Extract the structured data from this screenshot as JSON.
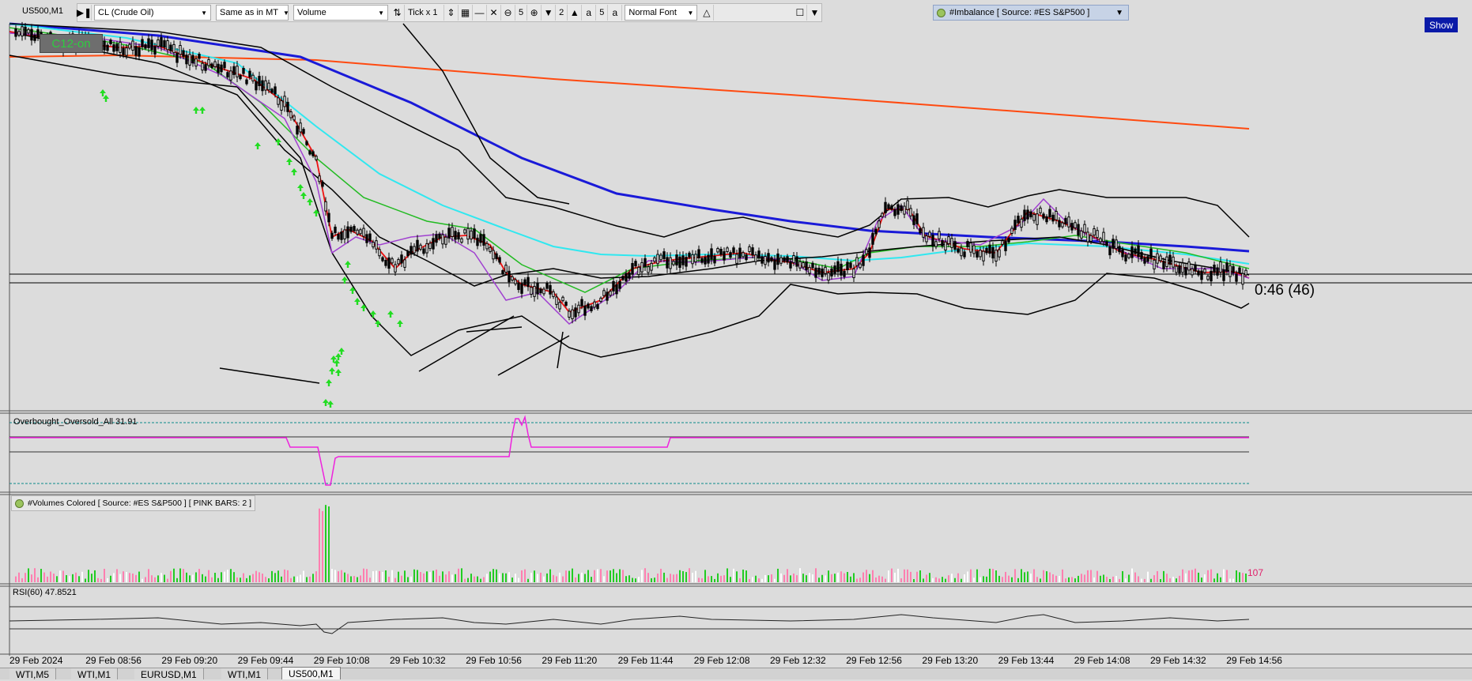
{
  "window": {
    "symbol": "US500,M1"
  },
  "toolbar": {
    "symbol_select": "CL (Crude Oil)",
    "timescale_select": "Same as in MT",
    "type_select": "Volume",
    "tick_label": "Tick x 1",
    "stepper1_value": "5",
    "stepper2_value": "2",
    "stepper3_value": "5",
    "font_select": "Normal Font"
  },
  "imbalance": {
    "label": "#Imbalance [ Source: #ES S&P500 ]"
  },
  "show_button": "Show",
  "c12_badge": "C12-on",
  "countdown": "0:46 (46)",
  "panels": {
    "overbought": "Overbought_Oversold_All 31.91",
    "volumes": "#Volumes Colored [ Source: #ES S&P500 ]  [ PINK BARS: 2 ]",
    "volumes_last": "107",
    "rsi": "RSI(60) 47.8521"
  },
  "time_axis": [
    "29 Feb 2024",
    "29 Feb 08:56",
    "29 Feb 09:20",
    "29 Feb 09:44",
    "29 Feb 10:08",
    "29 Feb 10:32",
    "29 Feb 10:56",
    "29 Feb 11:20",
    "29 Feb 11:44",
    "29 Feb 12:08",
    "29 Feb 12:32",
    "29 Feb 12:56",
    "29 Feb 13:20",
    "29 Feb 13:44",
    "29 Feb 14:08",
    "29 Feb 14:32",
    "29 Feb 14:56"
  ],
  "tabs": [
    "WTI,M5",
    "WTI,M1",
    "EURUSD,M1",
    "WTI,M1",
    "US500,M1"
  ],
  "colors": {
    "blue_ma": "#1a1ad8",
    "orange_ma": "#ff4a10",
    "cyan_ma": "#30e8f0",
    "green_ma": "#22bb22",
    "red_ma": "#ee1111",
    "purple_ma": "#a040d0",
    "magenta": "#ee22dd",
    "volume_green": "#22cc22",
    "volume_pink": "#ff7fb0"
  }
}
